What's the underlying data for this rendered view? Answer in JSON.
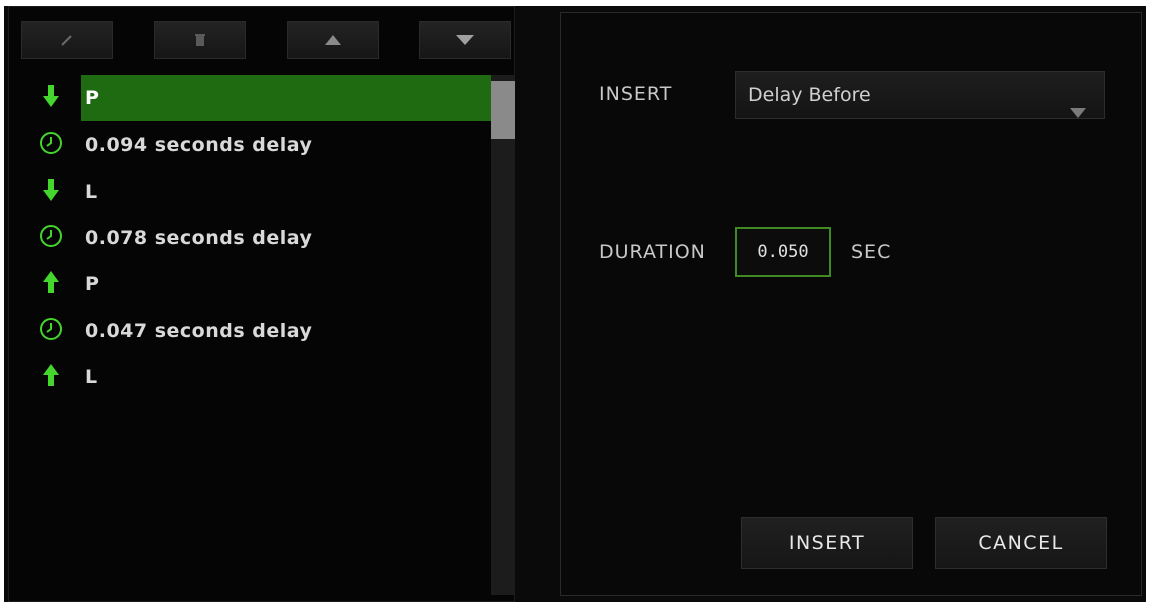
{
  "toolbar": {
    "buttons": [
      {
        "name": "edit",
        "icon": "pencil-icon"
      },
      {
        "name": "delete",
        "icon": "trash-icon"
      },
      {
        "name": "move-up",
        "icon": "triangle-up-icon"
      },
      {
        "name": "move-down",
        "icon": "triangle-down-icon"
      }
    ]
  },
  "list": {
    "items": [
      {
        "icon": "arrow-down-icon",
        "text": "P"
      },
      {
        "icon": "clock-icon",
        "text": "0.094 seconds delay"
      },
      {
        "icon": "arrow-down-icon",
        "text": "L"
      },
      {
        "icon": "clock-icon",
        "text": "0.078 seconds delay"
      },
      {
        "icon": "arrow-up-icon",
        "text": "P"
      },
      {
        "icon": "clock-icon",
        "text": "0.047 seconds delay"
      },
      {
        "icon": "arrow-up-icon",
        "text": "L"
      }
    ],
    "selected_index": 0
  },
  "insert_panel": {
    "insert_label": "INSERT",
    "insert_selected": "Delay Before",
    "duration_label": "DURATION",
    "duration_value": "0.050",
    "duration_unit": "SEC",
    "insert_button": "INSERT",
    "cancel_button": "CANCEL"
  },
  "colors": {
    "accent_green": "#44d62c",
    "selected_row": "#1e6b12",
    "input_border": "#3f8a23"
  }
}
